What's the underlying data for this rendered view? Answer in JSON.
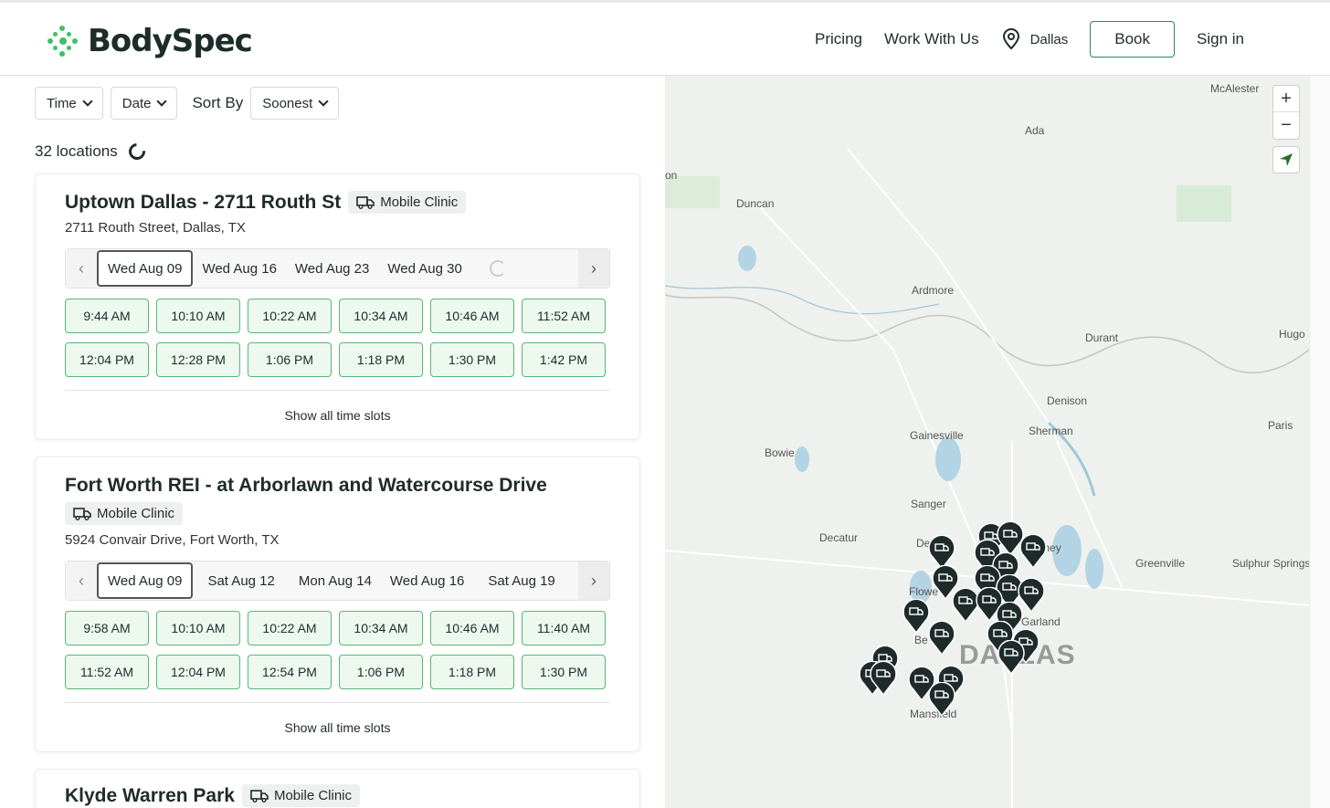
{
  "header": {
    "brand": "BodySpec",
    "nav": {
      "pricing": "Pricing",
      "work": "Work With Us",
      "location": "Dallas",
      "book": "Book",
      "signin": "Sign in"
    }
  },
  "filters": {
    "time": "Time",
    "date": "Date",
    "sort_label": "Sort By",
    "sort_value": "Soonest"
  },
  "results": {
    "count_text": "32 locations"
  },
  "cards": [
    {
      "title": "Uptown Dallas - 2711 Routh St",
      "badge": "Mobile Clinic",
      "address": "2711 Routh Street, Dallas, TX",
      "dates": [
        "Wed Aug 09",
        "Wed Aug 16",
        "Wed Aug 23",
        "Wed Aug 30"
      ],
      "slots": [
        "9:44 AM",
        "10:10 AM",
        "10:22 AM",
        "10:34 AM",
        "10:46 AM",
        "11:52 AM",
        "12:04 PM",
        "12:28 PM",
        "1:06 PM",
        "1:18 PM",
        "1:30 PM",
        "1:42 PM"
      ],
      "show_all": "Show all time slots"
    },
    {
      "title": "Fort Worth REI - at Arborlawn and Watercourse Drive",
      "badge": "Mobile Clinic",
      "address": "5924 Convair Drive, Fort Worth, TX",
      "dates": [
        "Wed Aug 09",
        "Sat Aug 12",
        "Mon Aug 14",
        "Wed Aug 16",
        "Sat Aug 19"
      ],
      "slots": [
        "9:58 AM",
        "10:10 AM",
        "10:22 AM",
        "10:34 AM",
        "10:46 AM",
        "11:40 AM",
        "11:52 AM",
        "12:04 PM",
        "12:54 PM",
        "1:06 PM",
        "1:18 PM",
        "1:30 PM"
      ],
      "show_all": "Show all time slots"
    },
    {
      "title": "Klyde Warren Park",
      "badge": "Mobile Clinic"
    }
  ],
  "map": {
    "labels": [
      "McAlester",
      "Ada",
      "on",
      "Duncan",
      "Ardmore",
      "Durant",
      "Hugo",
      "Denison",
      "Paris",
      "Sherman",
      "Gainesville",
      "Bowie",
      "Sanger",
      "Decatur",
      "De",
      "inney",
      "Greenville",
      "Sulphur Springs",
      "Flowe",
      "Garland",
      "Be",
      "DALLAS",
      "Mansfield"
    ],
    "zoom_in": "+",
    "zoom_out": "−"
  },
  "colors": {
    "accent_green": "#3fbf6a",
    "slot_border": "#57b876",
    "slot_bg": "#edf8ef",
    "marker": "#1f2b2a"
  }
}
